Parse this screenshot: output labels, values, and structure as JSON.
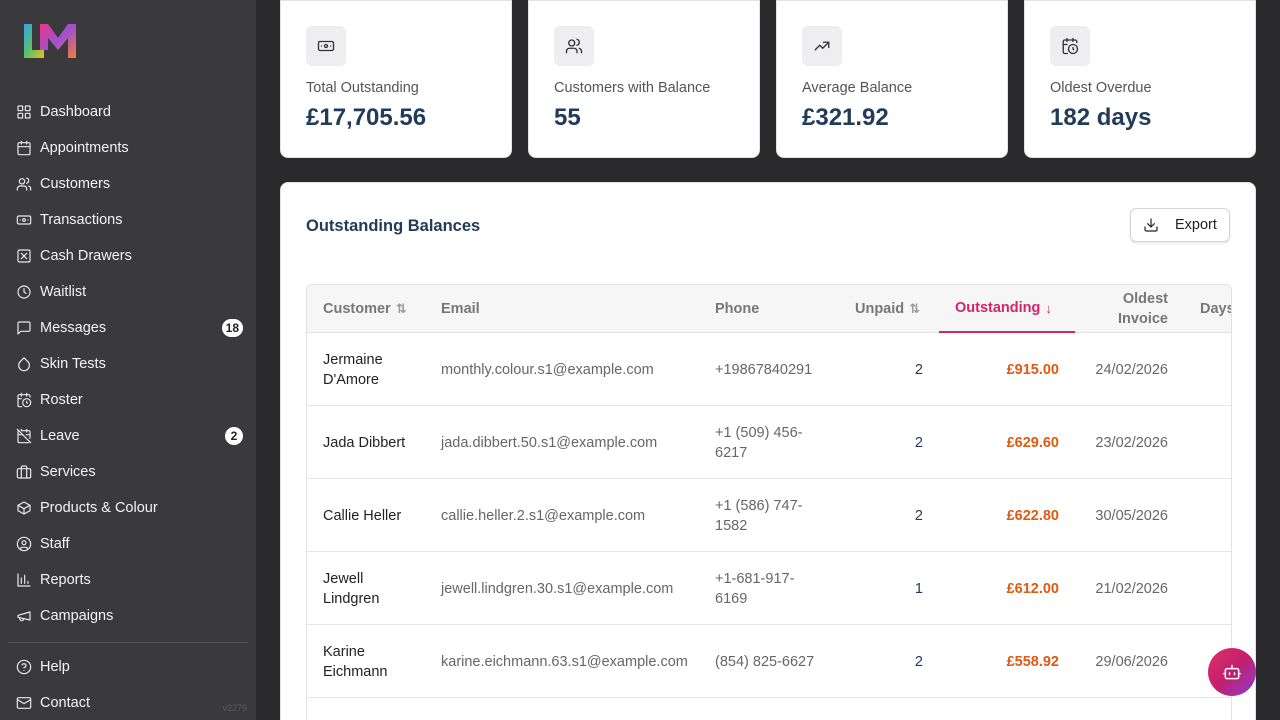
{
  "brand": {
    "logo_icon": "lm-logo-icon"
  },
  "sidebar": {
    "items": [
      {
        "label": "Dashboard",
        "icon": "grid-icon"
      },
      {
        "label": "Appointments",
        "icon": "calendar-icon"
      },
      {
        "label": "Customers",
        "icon": "users-icon"
      },
      {
        "label": "Transactions",
        "icon": "banknote-icon"
      },
      {
        "label": "Cash Drawers",
        "icon": "cash-drawer-icon"
      },
      {
        "label": "Waitlist",
        "icon": "clock-icon"
      },
      {
        "label": "Messages",
        "icon": "message-icon",
        "badge": "18"
      },
      {
        "label": "Skin Tests",
        "icon": "droplet-icon"
      },
      {
        "label": "Roster",
        "icon": "calendar-clock-icon"
      },
      {
        "label": "Leave",
        "icon": "calendar-off-icon",
        "badge": "2"
      },
      {
        "label": "Services",
        "icon": "briefcase-icon"
      },
      {
        "label": "Products & Colour",
        "icon": "package-icon"
      },
      {
        "label": "Staff",
        "icon": "user-circle-icon"
      },
      {
        "label": "Reports",
        "icon": "bar-chart-icon"
      },
      {
        "label": "Campaigns",
        "icon": "megaphone-icon"
      }
    ],
    "bottom_items": [
      {
        "label": "Help",
        "icon": "help-circle-icon"
      },
      {
        "label": "Contact",
        "icon": "mail-icon"
      }
    ],
    "version": "v2279"
  },
  "stats": [
    {
      "label": "Total Outstanding",
      "value": "£17,705.56",
      "icon": "banknote-icon"
    },
    {
      "label": "Customers with Balance",
      "value": "55",
      "icon": "users-icon"
    },
    {
      "label": "Average Balance",
      "value": "£321.92",
      "icon": "trending-up-icon"
    },
    {
      "label": "Oldest Overdue",
      "value": "182 days",
      "icon": "calendar-clock-icon"
    }
  ],
  "panel": {
    "title": "Outstanding Balances",
    "export_label": "Export"
  },
  "table": {
    "columns": {
      "customer": "Customer",
      "email": "Email",
      "phone": "Phone",
      "unpaid": "Unpaid",
      "outstanding": "Outstanding",
      "oldest_line1": "Oldest",
      "oldest_line2": "Invoice",
      "days": "Days"
    },
    "sort": {
      "column": "Outstanding",
      "direction": "descending"
    },
    "rows": [
      {
        "customer": "Jermaine D'Amore",
        "email": "monthly.colour.s1@example.com",
        "phone": "+19867840291",
        "unpaid": "2",
        "outstanding": "£915.00",
        "oldest_invoice": "24/02/2026"
      },
      {
        "customer": "Jada Dibbert",
        "email": "jada.dibbert.50.s1@example.com",
        "phone": "+1 (509) 456-6217",
        "unpaid": "2",
        "outstanding": "£629.60",
        "oldest_invoice": "23/02/2026"
      },
      {
        "customer": "Callie Heller",
        "email": "callie.heller.2.s1@example.com",
        "phone": "+1 (586) 747-1582",
        "unpaid": "2",
        "outstanding": "£622.80",
        "oldest_invoice": "30/05/2026"
      },
      {
        "customer": "Jewell Lindgren",
        "email": "jewell.lindgren.30.s1@example.com",
        "phone": "+1-681-917-6169",
        "unpaid": "1",
        "outstanding": "£612.00",
        "oldest_invoice": "21/02/2026"
      },
      {
        "customer": "Karine Eichmann",
        "email": "karine.eichmann.63.s1@example.com",
        "phone": "(854) 825-6627",
        "unpaid": "2",
        "outstanding": "£558.92",
        "oldest_invoice": "29/06/2026"
      }
    ]
  },
  "chat": {
    "icon": "bot-icon"
  },
  "colors": {
    "sidebar_bg": "#3a3a3c",
    "accent": "#d1246c",
    "amount": "#e05a10",
    "heading": "#233b5a"
  }
}
